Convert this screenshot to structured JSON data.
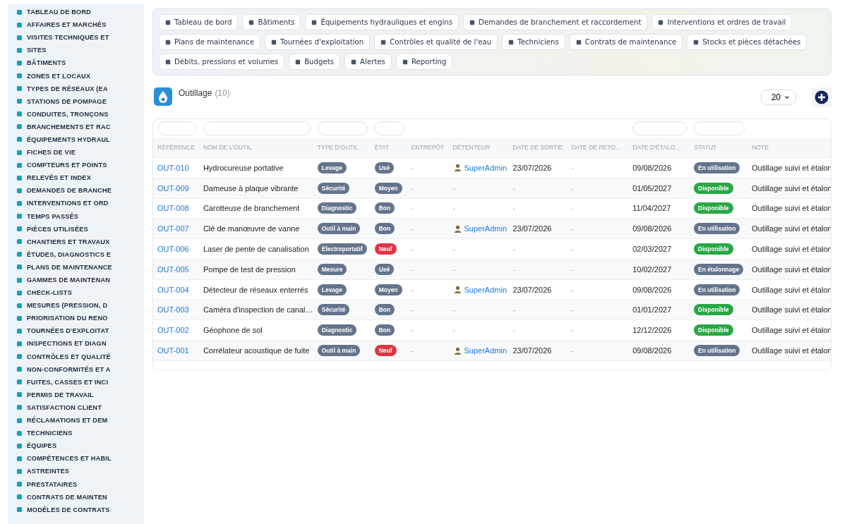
{
  "sidebar": {
    "items": [
      {
        "label": "TABLEAU DE BORD"
      },
      {
        "label": "AFFAIRES ET MARCHÉS"
      },
      {
        "label": "VISITES TECHNIQUES ET"
      },
      {
        "label": "SITES"
      },
      {
        "label": "BÂTIMENTS"
      },
      {
        "label": "ZONES ET LOCAUX"
      },
      {
        "label": "TYPES DE RÉSEAUX (EA"
      },
      {
        "label": "STATIONS DE POMPAGE"
      },
      {
        "label": "CONDUITES, TRONÇONS"
      },
      {
        "label": "BRANCHEMENTS ET RAC"
      },
      {
        "label": "ÉQUIPEMENTS HYDRAUL"
      },
      {
        "label": "FICHES DE VIE"
      },
      {
        "label": "COMPTEURS ET POINTS"
      },
      {
        "label": "RELEVÉS ET INDEX"
      },
      {
        "label": "DEMANDES DE BRANCHE"
      },
      {
        "label": "INTERVENTIONS ET ORD"
      },
      {
        "label": "TEMPS PASSÉS"
      },
      {
        "label": "PIÈCES UTILISÉES"
      },
      {
        "label": "CHANTIERS ET TRAVAUX"
      },
      {
        "label": "ÉTUDES, DIAGNOSTICS E"
      },
      {
        "label": "PLANS DE MAINTENANCE"
      },
      {
        "label": "GAMMES DE MAINTENAN"
      },
      {
        "label": "CHECK-LISTS"
      },
      {
        "label": "MESURES (PRESSION, D"
      },
      {
        "label": "PRIORISATION DU RENO"
      },
      {
        "label": "TOURNÉES D'EXPLOITAT"
      },
      {
        "label": "INSPECTIONS ET DIAGN"
      },
      {
        "label": "CONTRÔLES ET QUALITÉ"
      },
      {
        "label": "NON-CONFORMITÉS ET A"
      },
      {
        "label": "FUITES, CASSES ET INCI"
      },
      {
        "label": "PERMIS DE TRAVAIL"
      },
      {
        "label": "SATISFACTION CLIENT"
      },
      {
        "label": "RÉCLAMATIONS ET DEM"
      },
      {
        "label": "TECHNICIENS"
      },
      {
        "label": "ÉQUIPES"
      },
      {
        "label": "COMPÉTENCES ET HABIL"
      },
      {
        "label": "ASTREINTES"
      },
      {
        "label": "PRESTATAIRES"
      },
      {
        "label": "CONTRATS DE MAINTEN"
      },
      {
        "label": "MODÈLES DE CONTRATS"
      }
    ]
  },
  "quick_links": [
    {
      "label": "Tableau de bord"
    },
    {
      "label": "Bâtiments"
    },
    {
      "label": "Équipements hydrauliques et engins"
    },
    {
      "label": "Demandes de branchement et raccordement"
    },
    {
      "label": "Interventions et ordres de travail"
    },
    {
      "label": "Plans de maintenance"
    },
    {
      "label": "Tournées d'exploitation"
    },
    {
      "label": "Contrôles et qualité de l'eau"
    },
    {
      "label": "Techniciens"
    },
    {
      "label": "Contrats de maintenance"
    },
    {
      "label": "Stocks et pièces détachées"
    },
    {
      "label": "Débits, pressions et volumes"
    },
    {
      "label": "Budgets"
    },
    {
      "label": "Alertes"
    },
    {
      "label": "Reporting"
    }
  ],
  "header": {
    "title": "Outillage",
    "count": "(10)",
    "page_size": "20"
  },
  "table": {
    "columns": [
      {
        "label": "RÉFÉRENCE",
        "filter": true
      },
      {
        "label": "NOM DE L'OUTIL",
        "filter": true
      },
      {
        "label": "TYPE D'OUTIL",
        "filter": true
      },
      {
        "label": "ÉTAT",
        "filter": true
      },
      {
        "label": "ENTREPÔT",
        "filter": false
      },
      {
        "label": "DÉTENTEUR",
        "filter": false
      },
      {
        "label": "DATE DE SORTIE",
        "filter": false
      },
      {
        "label": "DATE DE RETO…",
        "filter": false
      },
      {
        "label": "DATE D'ÉTALO…",
        "filter": true
      },
      {
        "label": "STATUT",
        "filter": true
      },
      {
        "label": "NOTE",
        "filter": false
      }
    ],
    "rows": [
      {
        "ref": "OUT-010",
        "name": "Hydrocureuse portative",
        "type": "Levage",
        "etat": {
          "label": "Usé",
          "color": "#64748b"
        },
        "entrepot": "-",
        "holder": {
          "kind": "user",
          "text": "SuperAdmin"
        },
        "sortie": "23/07/2026",
        "retour": "-",
        "etalonnage": "09/08/2026",
        "statut": {
          "label": "En utilisation",
          "color": "#64748b"
        },
        "note": "Outillage suivi et étalon"
      },
      {
        "ref": "OUT-009",
        "name": "Dameuse à plaque vibrante",
        "type": "Sécurité",
        "etat": {
          "label": "Moyen",
          "color": "#64748b"
        },
        "entrepot": "-",
        "holder": {
          "kind": "none",
          "text": "-"
        },
        "sortie": "-",
        "retour": "-",
        "etalonnage": "01/05/2027",
        "statut": {
          "label": "Disponible",
          "color": "#28a745"
        },
        "note": "Outillage suivi et étalon"
      },
      {
        "ref": "OUT-008",
        "name": "Carotteuse de branchement",
        "type": "Diagnostic",
        "etat": {
          "label": "Bon",
          "color": "#64748b"
        },
        "entrepot": "-",
        "holder": {
          "kind": "none",
          "text": "-"
        },
        "sortie": "-",
        "retour": "-",
        "etalonnage": "11/04/2027",
        "statut": {
          "label": "Disponible",
          "color": "#28a745"
        },
        "note": "Outillage suivi et étalon"
      },
      {
        "ref": "OUT-007",
        "name": "Clé de manœuvre de vanne",
        "type": "Outil à main",
        "etat": {
          "label": "Bon",
          "color": "#64748b"
        },
        "entrepot": "-",
        "holder": {
          "kind": "user",
          "text": "SuperAdmin"
        },
        "sortie": "23/07/2026",
        "retour": "-",
        "etalonnage": "09/08/2026",
        "statut": {
          "label": "En utilisation",
          "color": "#64748b"
        },
        "note": "Outillage suivi et étalon"
      },
      {
        "ref": "OUT-006",
        "name": "Laser de pente de canalisation",
        "type": "Électroportatif",
        "etat": {
          "label": "Neuf",
          "color": "#dc3545"
        },
        "entrepot": "-",
        "holder": {
          "kind": "none",
          "text": "-"
        },
        "sortie": "-",
        "retour": "-",
        "etalonnage": "02/03/2027",
        "statut": {
          "label": "Disponible",
          "color": "#28a745"
        },
        "note": "Outillage suivi et étalon"
      },
      {
        "ref": "OUT-005",
        "name": "Pompe de test de pression",
        "type": "Mesure",
        "etat": {
          "label": "Usé",
          "color": "#64748b"
        },
        "entrepot": "-",
        "holder": {
          "kind": "none",
          "text": "-"
        },
        "sortie": "-",
        "retour": "-",
        "etalonnage": "10/02/2027",
        "statut": {
          "label": "En étalonnage",
          "color": "#64748b"
        },
        "note": "Outillage suivi et étalon"
      },
      {
        "ref": "OUT-004",
        "name": "Détecteur de réseaux enterrés",
        "type": "Levage",
        "etat": {
          "label": "Moyen",
          "color": "#64748b"
        },
        "entrepot": "-",
        "holder": {
          "kind": "user",
          "text": "SuperAdmin"
        },
        "sortie": "23/07/2026",
        "retour": "-",
        "etalonnage": "09/08/2026",
        "statut": {
          "label": "En utilisation",
          "color": "#64748b"
        },
        "note": "Outillage suivi et étalon"
      },
      {
        "ref": "OUT-003",
        "name": "Caméra d'inspection de canal…",
        "type": "Sécurité",
        "etat": {
          "label": "Bon",
          "color": "#64748b"
        },
        "entrepot": "-",
        "holder": {
          "kind": "none",
          "text": "-"
        },
        "sortie": "-",
        "retour": "-",
        "etalonnage": "01/01/2027",
        "statut": {
          "label": "Disponible",
          "color": "#28a745"
        },
        "note": "Outillage suivi et étalon"
      },
      {
        "ref": "OUT-002",
        "name": "Géophone de sol",
        "type": "Diagnostic",
        "etat": {
          "label": "Bon",
          "color": "#64748b"
        },
        "entrepot": "-",
        "holder": {
          "kind": "none",
          "text": "-"
        },
        "sortie": "-",
        "retour": "-",
        "etalonnage": "12/12/2026",
        "statut": {
          "label": "Disponible",
          "color": "#28a745"
        },
        "note": "Outillage suivi et étalon"
      },
      {
        "ref": "OUT-001",
        "name": "Corrélateur acoustique de fuite",
        "type": "Outil à main",
        "etat": {
          "label": "Neuf",
          "color": "#dc3545"
        },
        "entrepot": "-",
        "holder": {
          "kind": "user",
          "text": "SuperAdmin"
        },
        "sortie": "23/07/2026",
        "retour": "-",
        "etalonnage": "09/08/2026",
        "statut": {
          "label": "En utilisation",
          "color": "#64748b"
        },
        "note": "Outillage suivi et étalon"
      }
    ]
  }
}
